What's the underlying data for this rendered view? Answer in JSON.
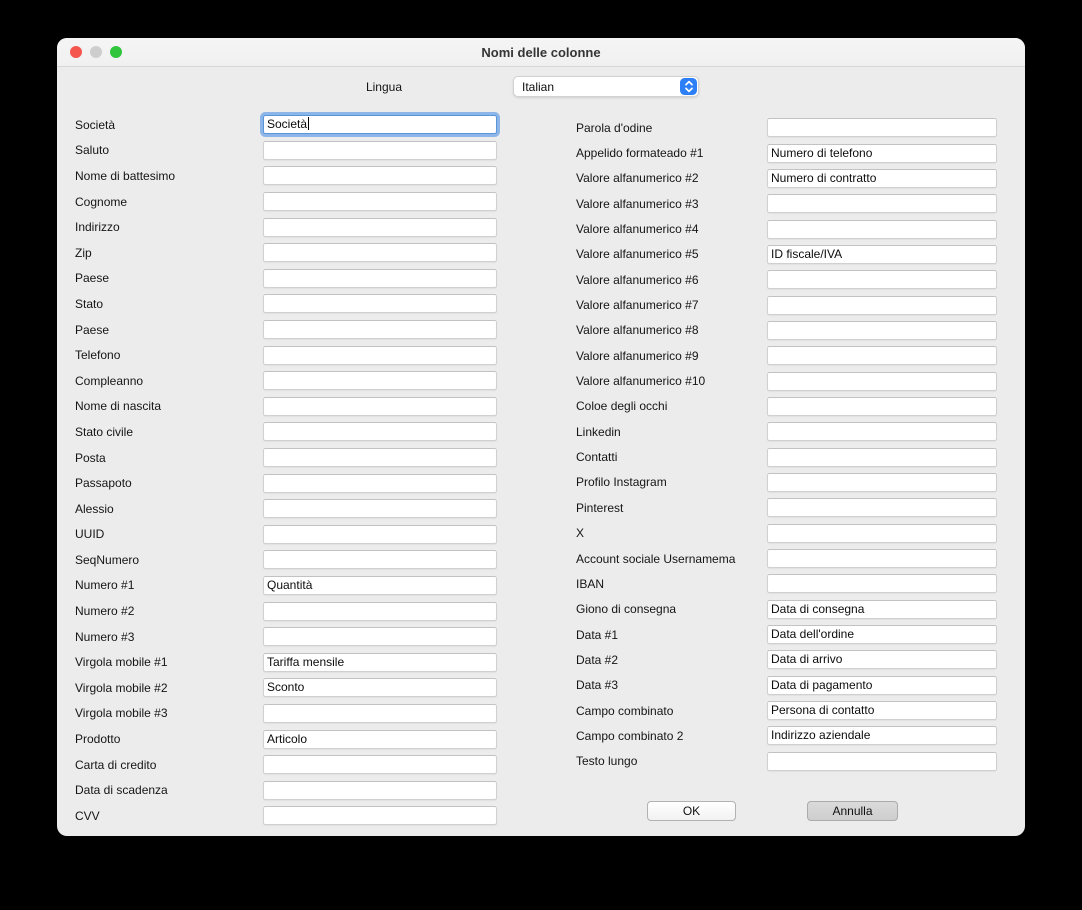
{
  "window": {
    "title": "Nomi delle colonne",
    "traffic_lights": [
      {
        "name": "close-button",
        "color": "#f4564d"
      },
      {
        "name": "minimize-button",
        "color": "#cdcdcd"
      },
      {
        "name": "zoom-button",
        "color": "#30c53c"
      }
    ]
  },
  "language": {
    "label": "Lingua",
    "value": "Italian",
    "stepper_color": "#2d7ff7"
  },
  "left_fields": [
    {
      "label": "Società",
      "value": "Società",
      "focused": true
    },
    {
      "label": "Saluto",
      "value": ""
    },
    {
      "label": "Nome di battesimo",
      "value": ""
    },
    {
      "label": "Cognome",
      "value": ""
    },
    {
      "label": "Indirizzo",
      "value": ""
    },
    {
      "label": "Zip",
      "value": ""
    },
    {
      "label": "Paese",
      "value": ""
    },
    {
      "label": "Stato",
      "value": ""
    },
    {
      "label": "Paese",
      "value": ""
    },
    {
      "label": "Telefono",
      "value": ""
    },
    {
      "label": "Compleanno",
      "value": ""
    },
    {
      "label": "Nome di nascita",
      "value": ""
    },
    {
      "label": "Stato civile",
      "value": ""
    },
    {
      "label": "Posta",
      "value": ""
    },
    {
      "label": "Passapoto",
      "value": ""
    },
    {
      "label": "Alessio",
      "value": ""
    },
    {
      "label": "UUID",
      "value": ""
    },
    {
      "label": "SeqNumero",
      "value": ""
    },
    {
      "label": "Numero #1",
      "value": "Quantità"
    },
    {
      "label": "Numero #2",
      "value": ""
    },
    {
      "label": "Numero #3",
      "value": ""
    },
    {
      "label": "Virgola mobile #1",
      "value": "Tariffa mensile"
    },
    {
      "label": "Virgola mobile #2",
      "value": "Sconto"
    },
    {
      "label": "Virgola mobile #3",
      "value": ""
    },
    {
      "label": "Prodotto",
      "value": "Articolo"
    },
    {
      "label": "Carta di credito",
      "value": ""
    },
    {
      "label": "Data di scadenza",
      "value": ""
    },
    {
      "label": "CVV",
      "value": ""
    }
  ],
  "right_fields": [
    {
      "label": "Parola d'odine",
      "value": ""
    },
    {
      "label": "Appelido formateado #1",
      "value": "Numero di telefono"
    },
    {
      "label": "Valore alfanumerico #2",
      "value": "Numero di contratto"
    },
    {
      "label": "Valore alfanumerico #3",
      "value": ""
    },
    {
      "label": "Valore alfanumerico #4",
      "value": ""
    },
    {
      "label": "Valore alfanumerico #5",
      "value": "ID fiscale/IVA"
    },
    {
      "label": "Valore alfanumerico #6",
      "value": ""
    },
    {
      "label": "Valore alfanumerico #7",
      "value": ""
    },
    {
      "label": "Valore alfanumerico #8",
      "value": ""
    },
    {
      "label": "Valore alfanumerico #9",
      "value": ""
    },
    {
      "label": "Valore alfanumerico #10",
      "value": ""
    },
    {
      "label": "Coloe degli occhi",
      "value": ""
    },
    {
      "label": "Linkedin",
      "value": ""
    },
    {
      "label": "Contatti",
      "value": ""
    },
    {
      "label": "Profilo Instagram",
      "value": ""
    },
    {
      "label": "Pinterest",
      "value": ""
    },
    {
      "label": "X",
      "value": ""
    },
    {
      "label": "Account sociale Usernamema",
      "value": ""
    },
    {
      "label": "IBAN",
      "value": ""
    },
    {
      "label": "Giono di consegna",
      "value": "Data di consegna"
    },
    {
      "label": "Data #1",
      "value": "Data dell'ordine"
    },
    {
      "label": "Data #2",
      "value": "Data di arrivo"
    },
    {
      "label": "Data #3",
      "value": "Data di pagamento"
    },
    {
      "label": "Campo combinato",
      "value": "Persona di contatto"
    },
    {
      "label": "Campo combinato 2",
      "value": "Indirizzo aziendale"
    },
    {
      "label": "Testo lungo",
      "value": ""
    }
  ],
  "buttons": {
    "ok": "OK",
    "cancel": "Annulla"
  }
}
